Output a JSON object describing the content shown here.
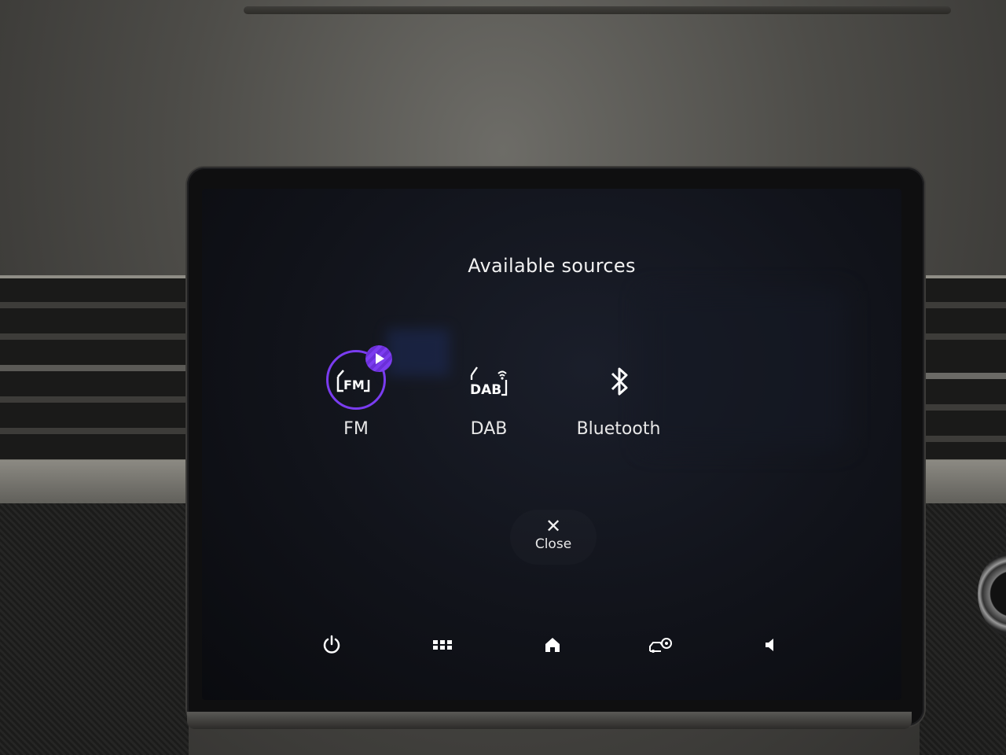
{
  "modal": {
    "title": "Available sources",
    "sources": [
      {
        "label": "FM",
        "icon": "fm-radio-icon",
        "active": true
      },
      {
        "label": "DAB",
        "icon": "dab-radio-icon",
        "active": false
      },
      {
        "label": "Bluetooth",
        "icon": "bluetooth-icon",
        "active": false
      }
    ],
    "close": {
      "icon": "close-icon",
      "label": "Close"
    }
  },
  "nav": [
    {
      "icon": "power-icon"
    },
    {
      "icon": "apps-grid-icon"
    },
    {
      "icon": "home-icon"
    },
    {
      "icon": "vehicle-settings-icon"
    },
    {
      "icon": "volume-icon"
    }
  ],
  "colors": {
    "accent": "#7a3cf0",
    "text": "#f2f2f2",
    "screen_bg": "#11131a"
  }
}
